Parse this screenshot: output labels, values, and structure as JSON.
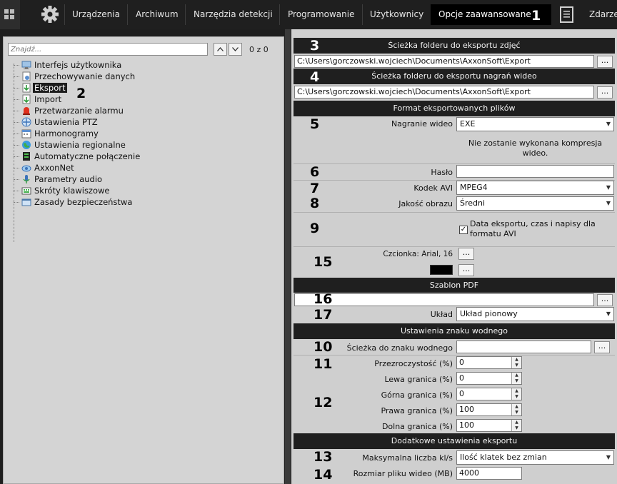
{
  "topbar": {
    "nav": [
      {
        "label": "Urządzenia",
        "active": false
      },
      {
        "label": "Archiwum",
        "active": false
      },
      {
        "label": "Narzędzia detekcji",
        "active": false
      },
      {
        "label": "Programowanie",
        "active": false
      },
      {
        "label": "Użytkownicy",
        "active": false
      },
      {
        "label": "Opcje zaawansowane",
        "active": true
      },
      {
        "label": "Zdarze",
        "active": false
      }
    ],
    "icons": {
      "grid": "grid-icon",
      "gear": "gear-icon",
      "doc": "document-list-icon"
    }
  },
  "callouts": {
    "n1": "1",
    "n2": "2",
    "n3": "3",
    "n4": "4",
    "n5": "5",
    "n6": "6",
    "n7": "7",
    "n8": "8",
    "n9": "9",
    "n10": "10",
    "n11": "11",
    "n12": "12",
    "n13": "13",
    "n14": "14",
    "n15": "15",
    "n16": "16",
    "n17": "17"
  },
  "left": {
    "search_placeholder": "Znajdź...",
    "counter": "0 z 0",
    "tree": [
      {
        "label": "Interfejs użytkownika",
        "icon": "monitor-icon"
      },
      {
        "label": "Przechowywanie danych",
        "icon": "storage-icon"
      },
      {
        "label": "Eksport",
        "icon": "export-icon",
        "selected": true
      },
      {
        "label": "Import",
        "icon": "import-icon"
      },
      {
        "label": "Przetwarzanie alarmu",
        "icon": "alarm-icon"
      },
      {
        "label": "Ustawienia PTZ",
        "icon": "ptz-icon"
      },
      {
        "label": "Harmonogramy",
        "icon": "schedule-icon"
      },
      {
        "label": "Ustawienia regionalne",
        "icon": "globe-icon"
      },
      {
        "label": "Automatyczne połączenie",
        "icon": "connect-icon"
      },
      {
        "label": "AxxonNet",
        "icon": "cloud-icon"
      },
      {
        "label": "Parametry audio",
        "icon": "audio-icon"
      },
      {
        "label": "Skróty klawiszowe",
        "icon": "keyboard-icon"
      },
      {
        "label": "Zasady bezpieczeństwa",
        "icon": "security-icon"
      }
    ]
  },
  "right": {
    "photo_path_header": "Ścieżka folderu do eksportu zdjęć",
    "photo_path": "C:\\Users\\gorczowski.wojciech\\Documents\\AxxonSoft\\Export",
    "video_path_header": "Ścieżka folderu do eksportu nagrań wideo",
    "video_path": "C:\\Users\\gorczowski.wojciech\\Documents\\AxxonSoft\\Export",
    "browse": "...",
    "format_header": "Format eksportowanych plików",
    "video_label": "Nagranie wideo",
    "video_value": "EXE",
    "compress_note": "Nie zostanie wykonana kompresja wideo.",
    "password_label": "Hasło",
    "codec_label": "Kodek AVI",
    "codec_value": "MPEG4",
    "quality_label": "Jakość obrazu",
    "quality_value": "Średni",
    "avi_note": "Data eksportu, czas i napisy dla formatu AVI",
    "font_label": "Czcionka: Arial, 16",
    "font_color": "#000000",
    "pdf_header": "Szablon PDF",
    "layout_label": "Układ",
    "layout_value": "Układ pionowy",
    "watermark_header": "Ustawienia znaku wodnego",
    "watermark_path_label": "Ścieżka do znaku wodnego",
    "opacity_label": "Przezroczystość (%)",
    "opacity_value": "0",
    "left_label": "Lewa granica (%)",
    "left_value": "0",
    "top_label": "Górna granica (%)",
    "top_value": "0",
    "right_label": "Prawa granica (%)",
    "right_value": "100",
    "bottom_label": "Dolna granica (%)",
    "bottom_value": "100",
    "extra_header": "Dodatkowe ustawienia eksportu",
    "max_fps_label": "Maksymalna liczba kl/s",
    "max_fps_value": "Ilość klatek bez zmian",
    "max_size_label": "Rozmiar pliku wideo (MB)",
    "max_size_value": "4000"
  }
}
